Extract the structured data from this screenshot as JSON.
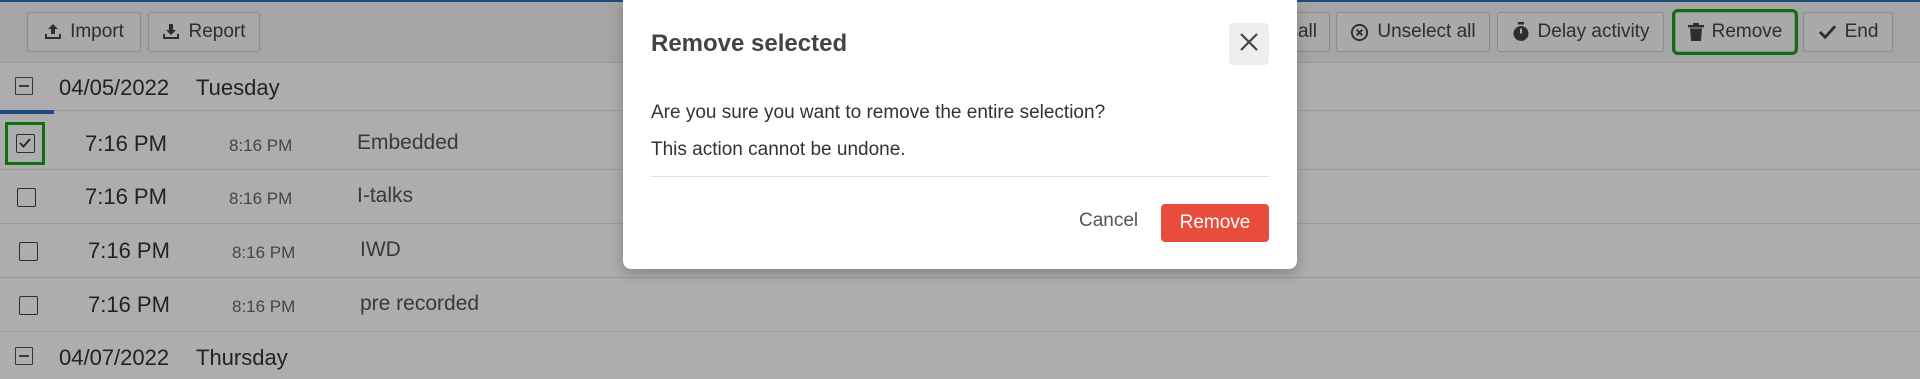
{
  "toolbar": {
    "left_buttons": [
      {
        "label": "Import",
        "icon": "upload-icon"
      },
      {
        "label": "Report",
        "icon": "download-icon"
      }
    ],
    "right_buttons": [
      {
        "label": "all",
        "icon": ""
      },
      {
        "label": "Unselect all",
        "icon": "circle-x-icon"
      },
      {
        "label": "Delay activity",
        "icon": "stopwatch-icon"
      },
      {
        "label": "Remove",
        "icon": "trash-icon"
      },
      {
        "label": "End",
        "icon": "check-icon"
      }
    ]
  },
  "schedule": {
    "groups": [
      {
        "date": "04/05/2022",
        "weekday": "Tuesday",
        "items": [
          {
            "start": "7:16 PM",
            "end": "8:16 PM",
            "name": "Embedded",
            "checked": true
          },
          {
            "start": "7:16 PM",
            "end": "8:16 PM",
            "name": "I-talks",
            "checked": false
          },
          {
            "start": "7:16 PM",
            "end": "8:16 PM",
            "name": "IWD",
            "checked": false
          },
          {
            "start": "7:16 PM",
            "end": "8:16 PM",
            "name": "pre recorded",
            "checked": false
          }
        ]
      },
      {
        "date": "04/07/2022",
        "weekday": "Thursday",
        "items": []
      }
    ]
  },
  "dialog": {
    "title": "Remove selected",
    "message_line1": "Are you sure you want to remove the entire selection?",
    "message_line2": "This action cannot be undone.",
    "cancel_label": "Cancel",
    "confirm_label": "Remove"
  },
  "colors": {
    "accent": "#2c6fb7",
    "danger": "#e84c3d",
    "highlight": "#19a319"
  }
}
